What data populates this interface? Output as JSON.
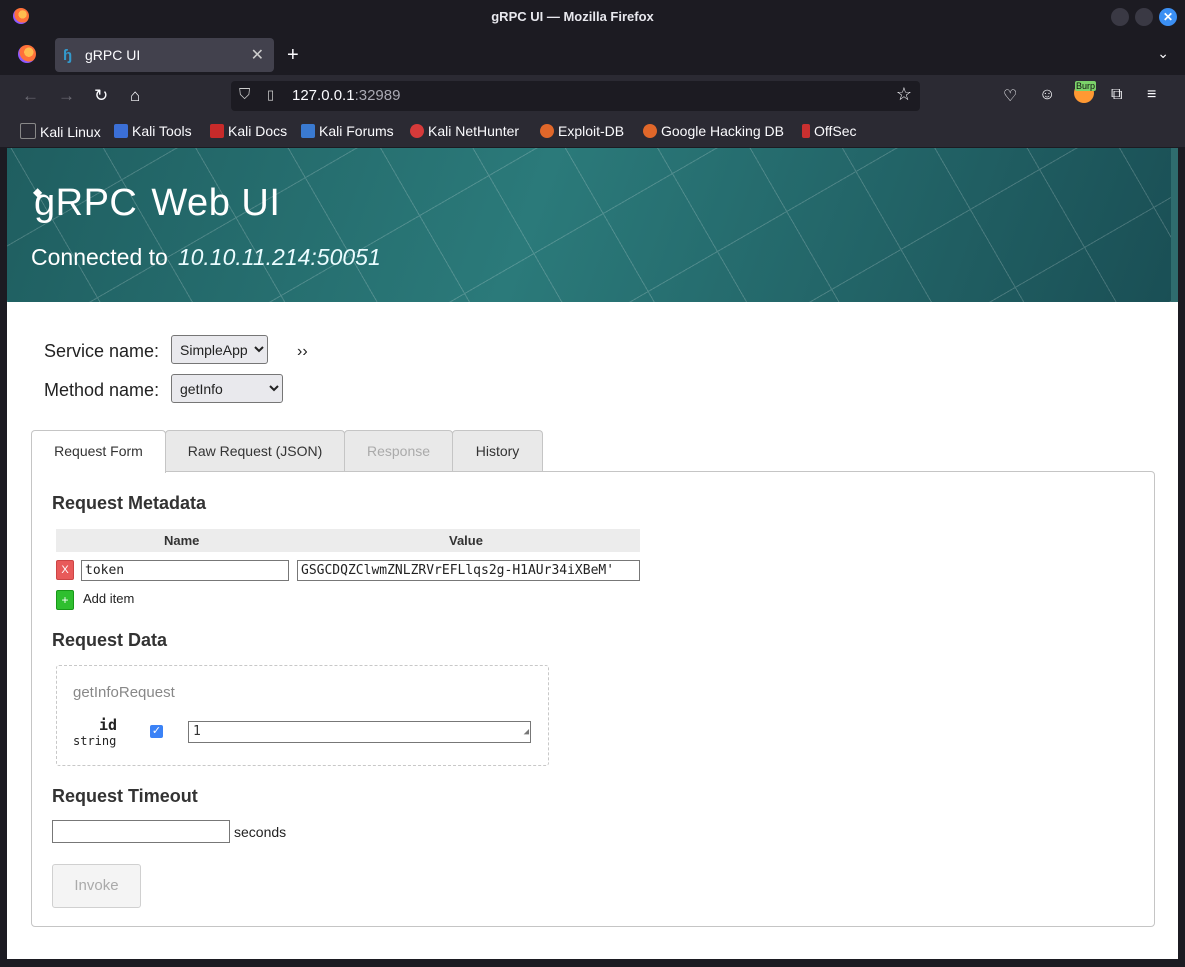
{
  "window": {
    "title": "gRPC UI — Mozilla Firefox",
    "controls": {
      "minimize": "",
      "maximize": "",
      "close": "✕"
    }
  },
  "tabs": [
    {
      "label": "gRPC UI",
      "icon": "grpc-tab-icon"
    }
  ],
  "navbar": {
    "url_host": "127.0.0.1",
    "url_port": ":32989",
    "burp_badge": "Burp"
  },
  "bookmarks": [
    {
      "label": "Kali Linux",
      "color": "#222222"
    },
    {
      "label": "Kali Tools",
      "color": "#3b6fd6"
    },
    {
      "label": "Kali Docs",
      "color": "#c72a2a"
    },
    {
      "label": "Kali Forums",
      "color": "#3a7ad1"
    },
    {
      "label": "Kali NetHunter",
      "color": "#d63a3a"
    },
    {
      "label": "Exploit-DB",
      "color": "#e0672a"
    },
    {
      "label": "Google Hacking DB",
      "color": "#e0672a"
    },
    {
      "label": "OffSec",
      "color": "#c93030"
    }
  ],
  "hero": {
    "logo_left": "gRPC",
    "logo_right": "Web UI",
    "connected_label": "Connected to",
    "address": "10.10.11.214:50051"
  },
  "form": {
    "service_label": "Service name:",
    "service_value": "SimpleApp",
    "method_label": "Method name:",
    "method_value": "getInfo",
    "expand": "››"
  },
  "form_tabs": [
    {
      "label": "Request Form",
      "state": "active"
    },
    {
      "label": "Raw Request (JSON)",
      "state": "normal"
    },
    {
      "label": "Response",
      "state": "disabled"
    },
    {
      "label": "History",
      "state": "normal"
    }
  ],
  "metadata": {
    "heading": "Request Metadata",
    "col_name": "Name",
    "col_value": "Value",
    "rows": [
      {
        "name": "token",
        "value": "GSGCDQZClwmZNLZRVrEFLlqs2g-H1AUr34iXBeM'"
      }
    ],
    "remove": "X",
    "add_symbol": "+",
    "add_label": "Add item"
  },
  "request_data": {
    "heading": "Request Data",
    "message": "getInfoRequest",
    "field_name": "id",
    "field_type": "string",
    "field_value": "1",
    "checkbox": "✓"
  },
  "timeout": {
    "heading": "Request Timeout",
    "value": "",
    "unit": "seconds"
  },
  "invoke_label": "Invoke"
}
